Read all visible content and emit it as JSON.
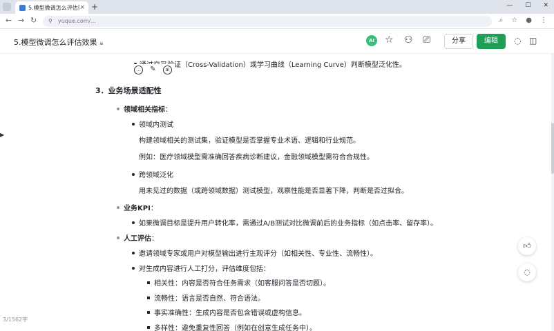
{
  "browser": {
    "tab_title": "5.模型微调怎么评估效果",
    "tab_close": "×",
    "new_tab": "+",
    "url": "yuque.com/...",
    "window_controls": [
      "—",
      "☐",
      "✕"
    ]
  },
  "header": {
    "doc_title": "5.模型微调怎么评估效果",
    "ai_label": "AI",
    "share_label": "分享",
    "edit_label": "编辑"
  },
  "content": {
    "partial_line": "通过交叉验证（Cross-Validation）或学习曲线（Learning Curve）判断模型泛化性。",
    "section3_title": "3．业务场景适配性",
    "domain_metrics": "领域相关指标",
    "colon": "：",
    "in_domain_test": "领域内测试",
    "in_domain_desc": "构建领域相关的测试集，验证模型是否掌握专业术语、逻辑和行业规范。",
    "in_domain_example": "例如：医疗领域模型需准确回答疾病诊断建议，金融领域模型需符合合规性。",
    "cross_domain": "跨领域泛化",
    "cross_domain_desc": "用未见过的数据（或跨领域数据）测试模型，观察性能是否显著下降，判断是否过拟合。",
    "business_kpi": "业务KPI",
    "kpi_desc": "如果微调目标是提升用户转化率，需通过A/B测试对比微调前后的业务指标（如点击率、留存率）。",
    "human_eval": "人工评估",
    "human_eval_1": "邀请领域专家或用户对模型输出进行主观评分（如相关性、专业性、流畅性）。",
    "human_eval_2": "对生成内容进行人工打分，评估维度包括：",
    "dim_1": "相关性：内容是否符合任务需求（如客服问答是否切题）。",
    "dim_2": "流畅性：语言是否自然、符合语法。",
    "dim_3": "事实准确性：生成内容是否包含错误或虚构信息。",
    "dim_4": "多样性：避免重复性回答（例如在创意生成任务中）。"
  },
  "footer": {
    "word_count": "3/1562字"
  }
}
